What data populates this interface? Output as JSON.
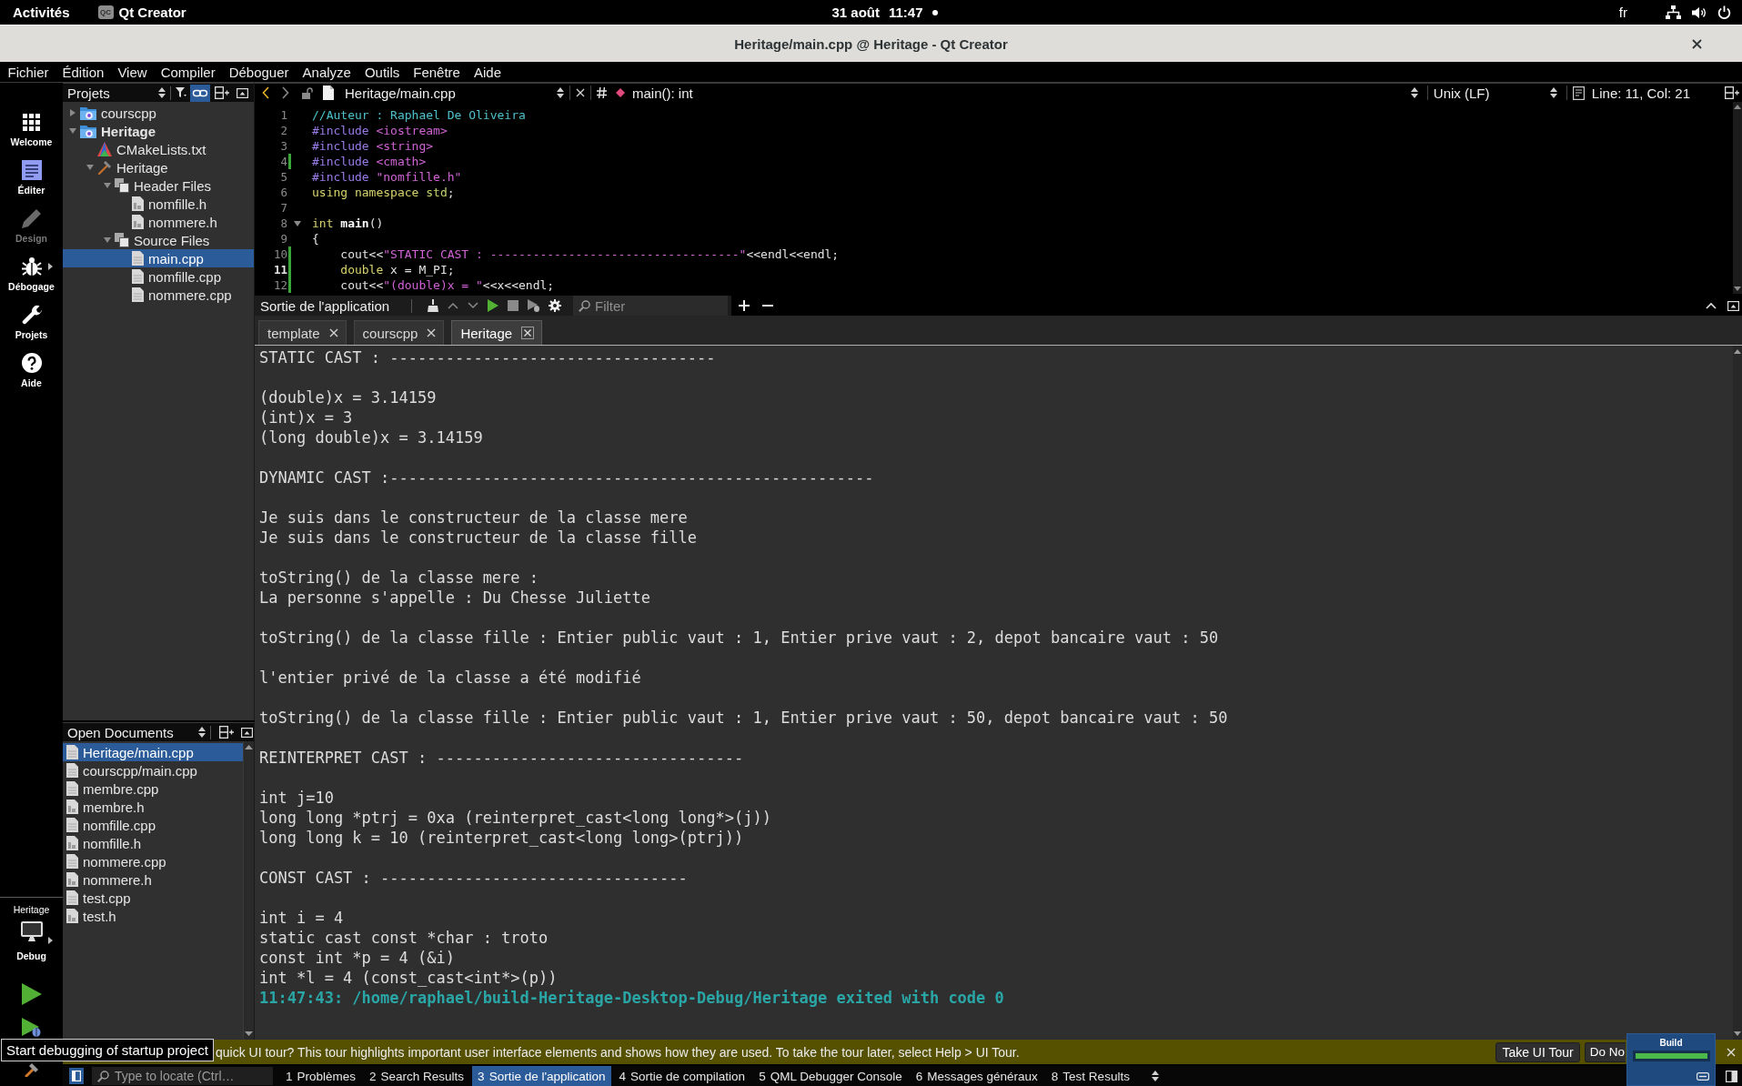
{
  "top_bar": {
    "activities": "Activités",
    "app_badge": "QC",
    "app": "Qt Creator",
    "date": "31 août",
    "time": "11:47",
    "notification": true,
    "keyboard": "fr"
  },
  "window": {
    "title": "Heritage/main.cpp @ Heritage - Qt Creator"
  },
  "menu": [
    "Fichier",
    "Édition",
    "View",
    "Compiler",
    "Déboguer",
    "Analyze",
    "Outils",
    "Fenêtre",
    "Aide"
  ],
  "modes": [
    {
      "kind": "welcome",
      "label": "Welcome",
      "selected": false,
      "disabled": false
    },
    {
      "kind": "edit",
      "label": "Éditer",
      "selected": true,
      "disabled": false
    },
    {
      "kind": "design",
      "label": "Design",
      "selected": false,
      "disabled": true
    },
    {
      "kind": "debug",
      "label": "Débogage",
      "selected": false,
      "disabled": false
    },
    {
      "kind": "projects",
      "label": "Projets",
      "selected": false,
      "disabled": false
    },
    {
      "kind": "help",
      "label": "Aide",
      "selected": false,
      "disabled": false
    }
  ],
  "kit": {
    "project": "Heritage",
    "build": "Debug"
  },
  "projects": {
    "title": "Projets",
    "link_toggle": {
      "on": true
    },
    "tree": [
      {
        "label": "courscpp",
        "kind": "project",
        "active": false,
        "expanded": false,
        "selected": false
      },
      {
        "label": "Heritage",
        "kind": "project",
        "active": true,
        "expanded": true,
        "selected": false,
        "children": [
          {
            "label": "CMakeLists.txt",
            "kind": "cmake",
            "selected": false
          },
          {
            "label": "Heritage",
            "kind": "target",
            "expanded": true,
            "selected": false,
            "children": [
              {
                "label": "Header Files",
                "kind": "group",
                "expanded": true,
                "selected": false,
                "children": [
                  {
                    "label": "nomfille.h",
                    "kind": "header",
                    "selected": false
                  },
                  {
                    "label": "nommere.h",
                    "kind": "header",
                    "selected": false
                  }
                ]
              },
              {
                "label": "Source Files",
                "kind": "group",
                "expanded": true,
                "selected": false,
                "children": [
                  {
                    "label": "main.cpp",
                    "kind": "source",
                    "selected": true
                  },
                  {
                    "label": "nomfille.cpp",
                    "kind": "source",
                    "selected": false
                  },
                  {
                    "label": "nommere.cpp",
                    "kind": "source",
                    "selected": false
                  }
                ]
              }
            ]
          }
        ]
      }
    ]
  },
  "open_documents": {
    "title": "Open Documents",
    "items": [
      {
        "label": "Heritage/main.cpp",
        "kind": "source",
        "selected": true
      },
      {
        "label": "courscpp/main.cpp",
        "kind": "source",
        "selected": false
      },
      {
        "label": "membre.cpp",
        "kind": "source",
        "selected": false
      },
      {
        "label": "membre.h",
        "kind": "header",
        "selected": false
      },
      {
        "label": "nomfille.cpp",
        "kind": "source",
        "selected": false
      },
      {
        "label": "nomfille.h",
        "kind": "header",
        "selected": false
      },
      {
        "label": "nommere.cpp",
        "kind": "source",
        "selected": false
      },
      {
        "label": "nommere.h",
        "kind": "header",
        "selected": false
      },
      {
        "label": "test.cpp",
        "kind": "source",
        "selected": false
      },
      {
        "label": "test.h",
        "kind": "header",
        "selected": false
      }
    ]
  },
  "editor": {
    "file": "Heritage/main.cpp",
    "symbol": "main(): int",
    "line_ending": "Unix (LF)",
    "position": "Line: 11, Col: 21",
    "lines": [
      {
        "number": "1",
        "changed": false,
        "current": false,
        "fold": false,
        "tokens": [
          {
            "kind": "comment",
            "text": "//Auteur : Raphael De Oliveira"
          }
        ]
      },
      {
        "number": "2",
        "changed": false,
        "current": false,
        "fold": false,
        "tokens": [
          {
            "kind": "preprocessor",
            "text": "#include "
          },
          {
            "kind": "include",
            "text": "<iostream>"
          }
        ]
      },
      {
        "number": "3",
        "changed": false,
        "current": false,
        "fold": false,
        "tokens": [
          {
            "kind": "preprocessor",
            "text": "#include "
          },
          {
            "kind": "include",
            "text": "<string>"
          }
        ]
      },
      {
        "number": "4",
        "changed": true,
        "current": false,
        "fold": false,
        "tokens": [
          {
            "kind": "preprocessor",
            "text": "#include "
          },
          {
            "kind": "include",
            "text": "<cmath>"
          }
        ]
      },
      {
        "number": "5",
        "changed": false,
        "current": false,
        "fold": false,
        "tokens": [
          {
            "kind": "preprocessor",
            "text": "#include "
          },
          {
            "kind": "include",
            "text": "\"nomfille.h\""
          }
        ]
      },
      {
        "number": "6",
        "changed": false,
        "current": false,
        "fold": false,
        "tokens": [
          {
            "kind": "keyword",
            "text": "using namespace "
          },
          {
            "kind": "type",
            "text": "std"
          },
          {
            "kind": "plain",
            "text": ";"
          }
        ]
      },
      {
        "number": "7",
        "changed": false,
        "current": false,
        "fold": false
      },
      {
        "number": "8",
        "changed": false,
        "current": false,
        "fold": true,
        "tokens": [
          {
            "kind": "keyword",
            "text": "int "
          },
          {
            "kind": "function",
            "text": "main"
          },
          {
            "kind": "plain",
            "text": "()"
          }
        ]
      },
      {
        "number": "9",
        "changed": false,
        "current": false,
        "fold": false,
        "tokens": [
          {
            "kind": "plain",
            "text": "{"
          }
        ]
      },
      {
        "number": "10",
        "changed": true,
        "current": false,
        "fold": false,
        "tokens": [
          {
            "kind": "plain",
            "text": "    cout<<"
          },
          {
            "kind": "string",
            "text": "\"STATIC CAST : -----------------------------------\""
          },
          {
            "kind": "plain",
            "text": "<<endl<<endl;"
          }
        ]
      },
      {
        "number": "11",
        "changed": true,
        "current": true,
        "fold": false,
        "tokens": [
          {
            "kind": "keyword",
            "text": "    double"
          },
          {
            "kind": "plain",
            "text": " x = M_PI;"
          }
        ]
      },
      {
        "number": "12",
        "changed": true,
        "current": false,
        "fold": false,
        "tokens": [
          {
            "kind": "plain",
            "text": "    cout<<"
          },
          {
            "kind": "string",
            "text": "\"(double)x = \""
          },
          {
            "kind": "plain",
            "text": "<<x<<endl;"
          }
        ]
      }
    ]
  },
  "output": {
    "title": "Sortie de l'application",
    "filter": {
      "placeholder": "Filter"
    },
    "tabs": [
      {
        "label": "template",
        "selected": false
      },
      {
        "label": "courscpp",
        "selected": false
      },
      {
        "label": "Heritage",
        "selected": true
      }
    ],
    "blocks": [
      [
        "STATIC CAST : -----------------------------------"
      ],
      [
        "(double)x = 3.14159",
        "(int)x = 3",
        "(long double)x = 3.14159"
      ],
      [
        "DYNAMIC CAST :----------------------------------------------------"
      ],
      [
        "Je suis dans le constructeur de la classe mere",
        "Je suis dans le constructeur de la classe fille"
      ],
      [
        "toString() de la classe mere :",
        "La personne s'appelle : Du Chesse Juliette"
      ],
      [
        "toString() de la classe fille : Entier public vaut : 1, Entier prive vaut : 2, depot bancaire vaut : 50"
      ],
      [
        "l'entier privé de la classe a été modifié"
      ],
      [
        "toString() de la classe fille : Entier public vaut : 1, Entier prive vaut : 50, depot bancaire vaut : 50"
      ],
      [
        "REINTERPRET CAST : ---------------------------------"
      ],
      [
        "int j=10",
        "long long *ptrj = 0xa (reinterpret_cast<long long*>(j))",
        "long long k = 10 (reinterpret_cast<long long>(ptrj))"
      ],
      [
        "CONST CAST : ---------------------------------"
      ],
      [
        "int i = 4",
        "static cast const *char : troto",
        "const int *p = 4 (&i)",
        "int *l = 4 (const_cast<int*>(p))"
      ]
    ],
    "exit_message": "11:47:43: /home/raphael/build-Heritage-Desktop-Debug/Heritage exited with code 0"
  },
  "info_bar": {
    "message": "quick UI tour? This tour highlights important user interface elements and shows how they are used. To take the tour later, select Help > UI Tour.",
    "buttons": [
      "Take UI Tour",
      "Do No"
    ]
  },
  "build_progress": {
    "label": "Build",
    "level": 1
  },
  "tooltip": "Start debugging of startup project",
  "status_bar": {
    "locate": {
      "placeholder": "Type to locate (Ctrl…"
    },
    "panes": [
      {
        "number": "1",
        "label": "Problèmes",
        "selected": false
      },
      {
        "number": "2",
        "label": "Search Results",
        "selected": false
      },
      {
        "number": "3",
        "label": "Sortie de l'application",
        "selected": true
      },
      {
        "number": "4",
        "label": "Sortie de compilation",
        "selected": false
      },
      {
        "number": "5",
        "label": "QML Debugger Console",
        "selected": false
      },
      {
        "number": "6",
        "label": "Messages généraux",
        "selected": false
      },
      {
        "number": "8",
        "label": "Test Results",
        "selected": false
      }
    ]
  }
}
